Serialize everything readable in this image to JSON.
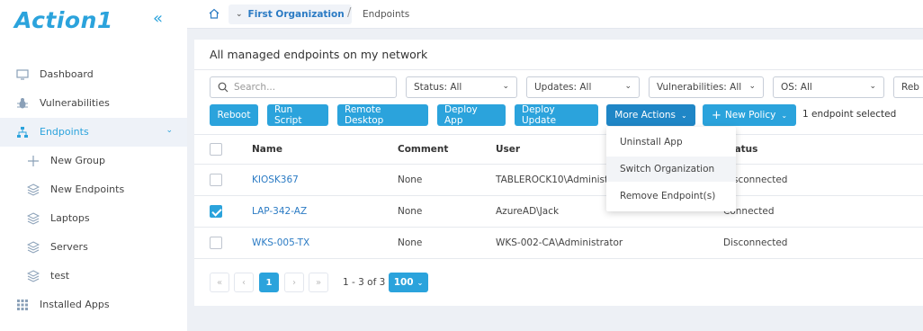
{
  "app": {
    "logo": "Action1",
    "collapse_icon": "«"
  },
  "sidebar": {
    "items": [
      {
        "label": "Dashboard",
        "icon": "dashboard-icon"
      },
      {
        "label": "Vulnerabilities",
        "icon": "bug-icon"
      },
      {
        "label": "Endpoints",
        "icon": "network-icon",
        "active": true
      },
      {
        "label": "New Group",
        "icon": "plus-icon"
      },
      {
        "label": "New Endpoints",
        "icon": "layers-icon"
      },
      {
        "label": "Laptops",
        "icon": "layers-icon"
      },
      {
        "label": "Servers",
        "icon": "layers-icon"
      },
      {
        "label": "test",
        "icon": "layers-icon"
      },
      {
        "label": "Installed Apps",
        "icon": "grid-icon"
      }
    ]
  },
  "topbar": {
    "org": "First Organization",
    "sep": "/",
    "crumb": "Endpoints"
  },
  "panel": {
    "title": "All managed endpoints on my network"
  },
  "filters": {
    "search_placeholder": "Search...",
    "status": "Status: All",
    "updates": "Updates: All",
    "vulnerabilities": "Vulnerabilities: All",
    "os": "OS: All",
    "more": "Reb"
  },
  "toolbar": {
    "reboot": "Reboot",
    "run_script": "Run Script",
    "remote_desktop": "Remote Desktop",
    "deploy_app": "Deploy App",
    "deploy_update": "Deploy Update",
    "more_actions": "More Actions",
    "new_policy": "New Policy",
    "selected": "1 endpoint selected"
  },
  "table": {
    "headers": {
      "name": "Name",
      "comment": "Comment",
      "user": "User",
      "status": "Status"
    },
    "rows": [
      {
        "name": "KIOSK367",
        "comment": "None",
        "user": "TABLEROCK10\\Administr",
        "status": "Disconnected",
        "checked": false
      },
      {
        "name": "LAP-342-AZ",
        "comment": "None",
        "user": "AzureAD\\Jack",
        "status": "Connected",
        "checked": true
      },
      {
        "name": "WKS-005-TX",
        "comment": "None",
        "user": "WKS-002-CA\\Administrator",
        "status": "Disconnected",
        "checked": false
      }
    ]
  },
  "pagination": {
    "first": "«",
    "prev": "‹",
    "page": "1",
    "next": "›",
    "last": "»",
    "info": "1 - 3 of 3",
    "size": "100"
  },
  "dropdown": {
    "items": [
      "Uninstall App",
      "Switch Organization",
      "Remove Endpoint(s)"
    ]
  }
}
